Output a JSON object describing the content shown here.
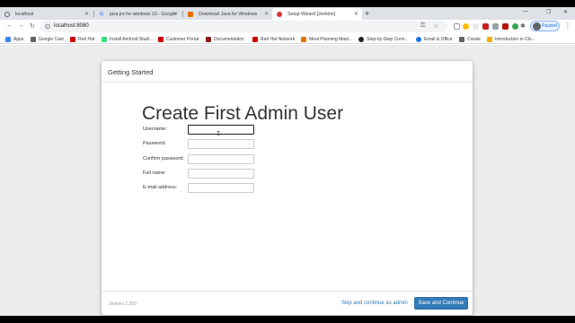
{
  "tabs": [
    {
      "title": "localhost",
      "favicon": "globe-icon",
      "active": false
    },
    {
      "title": "java jre for windows 10 - Google",
      "favicon": "google-icon",
      "active": false
    },
    {
      "title": "Download Java for Windows",
      "favicon": "java-icon",
      "active": false
    },
    {
      "title": "Setup Wizard [Jenkins]",
      "favicon": "jenkins-icon",
      "active": true
    }
  ],
  "address_bar": {
    "url": "localhost:8080"
  },
  "profile": {
    "label": "Paused"
  },
  "bookmarks": [
    {
      "label": "Apps",
      "color": "#4285f4"
    },
    {
      "label": "Google Cast",
      "color": "#5f6368"
    },
    {
      "label": "Red Hat",
      "color": "#cc0000"
    },
    {
      "label": "Install Android Studi...",
      "color": "#3ddc84"
    },
    {
      "label": "Customer Portal",
      "color": "#cc0000"
    },
    {
      "label": "Documentation",
      "color": "#8b1a1a"
    },
    {
      "label": "Red Hat Network",
      "color": "#cc0000"
    },
    {
      "label": "Meal Planning Mast...",
      "color": "#e37400"
    },
    {
      "label": "Step-by-Step Conn...",
      "color": "#202124"
    },
    {
      "label": "Email & Office",
      "color": "#1a73e8"
    },
    {
      "label": "Create",
      "color": "#5f6368"
    },
    {
      "label": "Introduction to Clo...",
      "color": "#f9ab00"
    }
  ],
  "dialog": {
    "header": "Getting Started",
    "heading": "Create First Admin User",
    "fields": [
      {
        "label": "Username:",
        "value": ""
      },
      {
        "label": "Password:",
        "value": ""
      },
      {
        "label": "Confirm password:",
        "value": ""
      },
      {
        "label": "Full name:",
        "value": ""
      },
      {
        "label": "E-mail address:",
        "value": ""
      }
    ],
    "version": "Jenkins 2.250",
    "skip_label": "Skip and continue as admin",
    "save_label": "Save and Continue"
  },
  "colors": {
    "primary": "#337ab7",
    "page_bg": "#ececec"
  }
}
